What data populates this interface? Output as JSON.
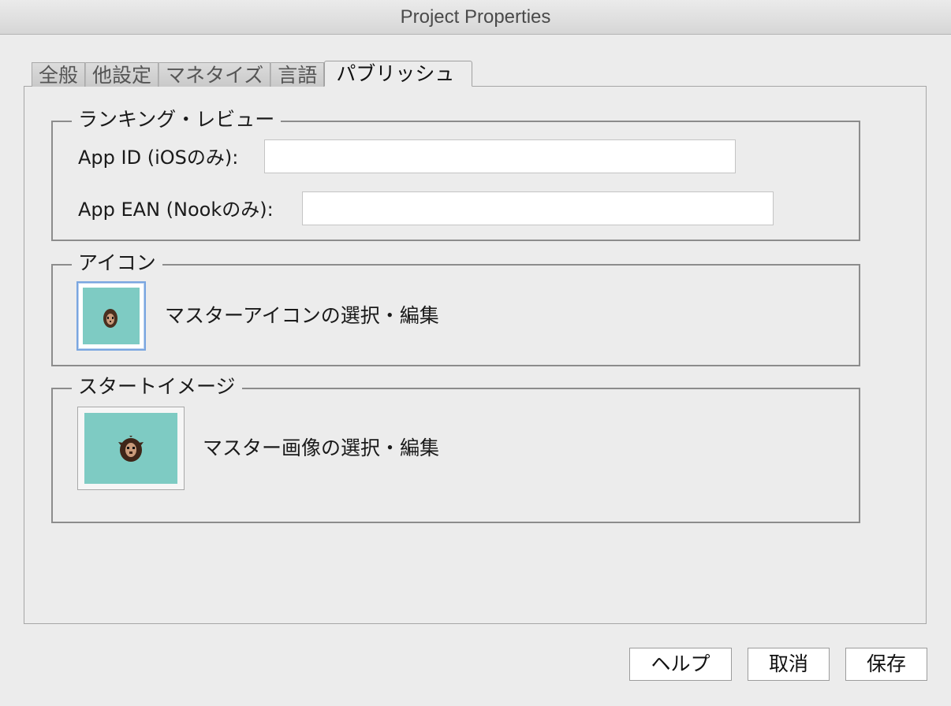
{
  "window": {
    "title": "Project Properties"
  },
  "tabs": [
    {
      "label": "全般"
    },
    {
      "label": "他設定"
    },
    {
      "label": "マネタイズ"
    },
    {
      "label": "言語"
    },
    {
      "label": "パブリッシュ",
      "active": true
    }
  ],
  "ranking": {
    "legend": "ランキング・レビュー",
    "app_id_label": "App ID (iOSのみ):",
    "app_id_value": "",
    "app_ean_label": "App EAN (Nookのみ):",
    "app_ean_value": ""
  },
  "icon_section": {
    "legend": "アイコン",
    "button_label": "マスターアイコンの選択・編集"
  },
  "start_image": {
    "legend": "スタートイメージ",
    "button_label": "マスター画像の選択・編集"
  },
  "footer": {
    "help_label": "ヘルプ",
    "cancel_label": "取消",
    "save_label": "保存"
  },
  "colors": {
    "thumbnail_bg": "#7ecbc3",
    "focus_ring": "#7aa6e0"
  }
}
